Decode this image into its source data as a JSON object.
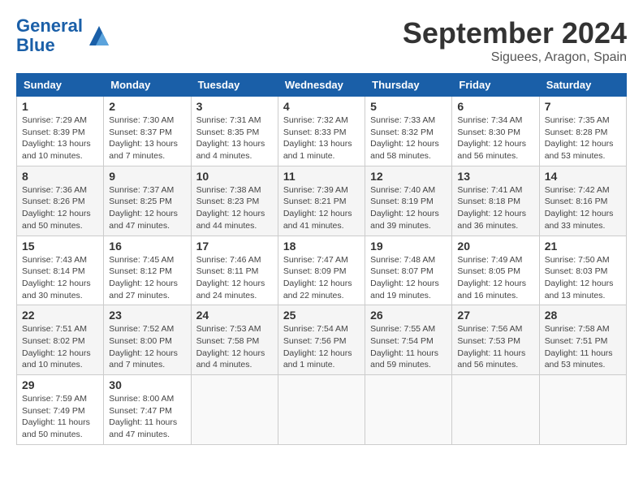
{
  "header": {
    "logo_line1": "General",
    "logo_line2": "Blue",
    "month_title": "September 2024",
    "location": "Siguees, Aragon, Spain"
  },
  "columns": [
    "Sunday",
    "Monday",
    "Tuesday",
    "Wednesday",
    "Thursday",
    "Friday",
    "Saturday"
  ],
  "weeks": [
    [
      {
        "day": "1",
        "info": "Sunrise: 7:29 AM\nSunset: 8:39 PM\nDaylight: 13 hours and 10 minutes."
      },
      {
        "day": "2",
        "info": "Sunrise: 7:30 AM\nSunset: 8:37 PM\nDaylight: 13 hours and 7 minutes."
      },
      {
        "day": "3",
        "info": "Sunrise: 7:31 AM\nSunset: 8:35 PM\nDaylight: 13 hours and 4 minutes."
      },
      {
        "day": "4",
        "info": "Sunrise: 7:32 AM\nSunset: 8:33 PM\nDaylight: 13 hours and 1 minute."
      },
      {
        "day": "5",
        "info": "Sunrise: 7:33 AM\nSunset: 8:32 PM\nDaylight: 12 hours and 58 minutes."
      },
      {
        "day": "6",
        "info": "Sunrise: 7:34 AM\nSunset: 8:30 PM\nDaylight: 12 hours and 56 minutes."
      },
      {
        "day": "7",
        "info": "Sunrise: 7:35 AM\nSunset: 8:28 PM\nDaylight: 12 hours and 53 minutes."
      }
    ],
    [
      {
        "day": "8",
        "info": "Sunrise: 7:36 AM\nSunset: 8:26 PM\nDaylight: 12 hours and 50 minutes."
      },
      {
        "day": "9",
        "info": "Sunrise: 7:37 AM\nSunset: 8:25 PM\nDaylight: 12 hours and 47 minutes."
      },
      {
        "day": "10",
        "info": "Sunrise: 7:38 AM\nSunset: 8:23 PM\nDaylight: 12 hours and 44 minutes."
      },
      {
        "day": "11",
        "info": "Sunrise: 7:39 AM\nSunset: 8:21 PM\nDaylight: 12 hours and 41 minutes."
      },
      {
        "day": "12",
        "info": "Sunrise: 7:40 AM\nSunset: 8:19 PM\nDaylight: 12 hours and 39 minutes."
      },
      {
        "day": "13",
        "info": "Sunrise: 7:41 AM\nSunset: 8:18 PM\nDaylight: 12 hours and 36 minutes."
      },
      {
        "day": "14",
        "info": "Sunrise: 7:42 AM\nSunset: 8:16 PM\nDaylight: 12 hours and 33 minutes."
      }
    ],
    [
      {
        "day": "15",
        "info": "Sunrise: 7:43 AM\nSunset: 8:14 PM\nDaylight: 12 hours and 30 minutes."
      },
      {
        "day": "16",
        "info": "Sunrise: 7:45 AM\nSunset: 8:12 PM\nDaylight: 12 hours and 27 minutes."
      },
      {
        "day": "17",
        "info": "Sunrise: 7:46 AM\nSunset: 8:11 PM\nDaylight: 12 hours and 24 minutes."
      },
      {
        "day": "18",
        "info": "Sunrise: 7:47 AM\nSunset: 8:09 PM\nDaylight: 12 hours and 22 minutes."
      },
      {
        "day": "19",
        "info": "Sunrise: 7:48 AM\nSunset: 8:07 PM\nDaylight: 12 hours and 19 minutes."
      },
      {
        "day": "20",
        "info": "Sunrise: 7:49 AM\nSunset: 8:05 PM\nDaylight: 12 hours and 16 minutes."
      },
      {
        "day": "21",
        "info": "Sunrise: 7:50 AM\nSunset: 8:03 PM\nDaylight: 12 hours and 13 minutes."
      }
    ],
    [
      {
        "day": "22",
        "info": "Sunrise: 7:51 AM\nSunset: 8:02 PM\nDaylight: 12 hours and 10 minutes."
      },
      {
        "day": "23",
        "info": "Sunrise: 7:52 AM\nSunset: 8:00 PM\nDaylight: 12 hours and 7 minutes."
      },
      {
        "day": "24",
        "info": "Sunrise: 7:53 AM\nSunset: 7:58 PM\nDaylight: 12 hours and 4 minutes."
      },
      {
        "day": "25",
        "info": "Sunrise: 7:54 AM\nSunset: 7:56 PM\nDaylight: 12 hours and 1 minute."
      },
      {
        "day": "26",
        "info": "Sunrise: 7:55 AM\nSunset: 7:54 PM\nDaylight: 11 hours and 59 minutes."
      },
      {
        "day": "27",
        "info": "Sunrise: 7:56 AM\nSunset: 7:53 PM\nDaylight: 11 hours and 56 minutes."
      },
      {
        "day": "28",
        "info": "Sunrise: 7:58 AM\nSunset: 7:51 PM\nDaylight: 11 hours and 53 minutes."
      }
    ],
    [
      {
        "day": "29",
        "info": "Sunrise: 7:59 AM\nSunset: 7:49 PM\nDaylight: 11 hours and 50 minutes."
      },
      {
        "day": "30",
        "info": "Sunrise: 8:00 AM\nSunset: 7:47 PM\nDaylight: 11 hours and 47 minutes."
      },
      null,
      null,
      null,
      null,
      null
    ]
  ]
}
